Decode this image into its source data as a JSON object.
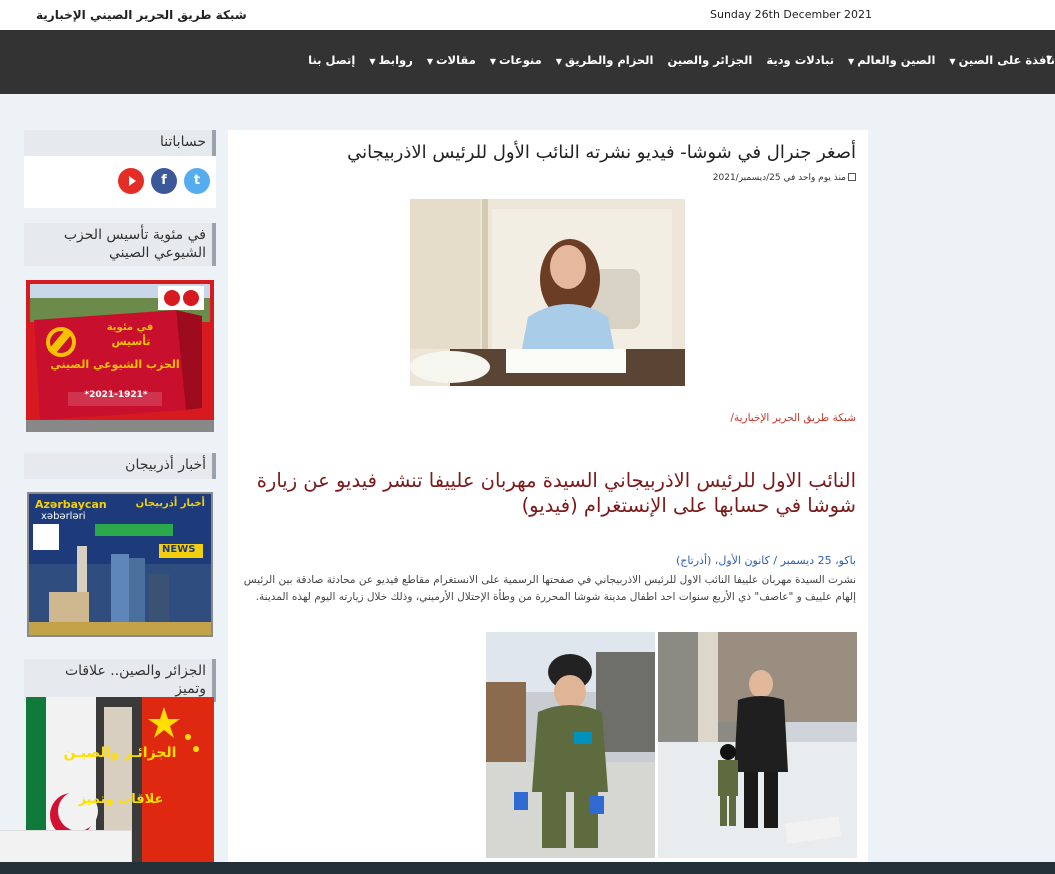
{
  "topbar": {
    "site_name": "شبكة طريق الحرير الصيني الإخبارية",
    "date": "Sunday 26th December 2021"
  },
  "nav": {
    "items": [
      {
        "label": "نافذة على الصين",
        "dropdown": true
      },
      {
        "label": "الصين والعالم",
        "dropdown": true
      },
      {
        "label": "تبادلات ودية",
        "dropdown": false
      },
      {
        "label": "الجزائر والصين",
        "dropdown": false
      },
      {
        "label": "الحزام والطريق",
        "dropdown": true
      },
      {
        "label": "منوعات",
        "dropdown": true
      },
      {
        "label": "مقالات",
        "dropdown": true
      },
      {
        "label": "روابط",
        "dropdown": true
      },
      {
        "label": "إتصل بنا",
        "dropdown": false
      }
    ]
  },
  "sidebar": {
    "accounts_title": "حساباتنا",
    "social": [
      "twitter-icon",
      "facebook-icon",
      "youtube-icon"
    ],
    "cpc_title": "في مئوية تأسيس الحزب الشيوعي الصيني",
    "cpc_banner": {
      "line1": "في مئوية",
      "line2": "تأسيس",
      "line3": "الحزب الشيوعي الصيني",
      "years": "*2021-1921*"
    },
    "azer_title": "أخبار أذربيجان",
    "azer_banner": {
      "ar": "أخبار أذربيجان",
      "az1": "Azərbaycan",
      "az2": "xəbərləri",
      "news": "NEWS"
    },
    "algeria_title": "الجزائر والصين.. علاقات وتميز",
    "algeria_banner": {
      "line1": "الجزائـر والصيـن",
      "line2": "علاقات وتميز"
    }
  },
  "article": {
    "title": "أصغر جنرال في شوشا- فيديو نشرته النائب الأول للرئيس الاذربيجاني",
    "meta": "منذ يوم واحد في 25/ديسمبر/2021",
    "source": "شبكة طريق الحرير الإخبارية/",
    "headline": "النائب الاول للرئيس الاذربيجاني السيدة مهربان علييفا تنشر فيديو عن زيارة شوشا في حسابها على الإنستغرام (فيديو)",
    "dateline": "باكو، 25 ديسمبر / كانون الأول، (أذرتاج)",
    "body": "نشرت السيدة مهربان علييفا النائب الاول للرئيس الاذربيجاني في صفحتها الرسمية على الانستغرام مقاطع فيديو عن محادثة صادقة بين الرئيس إلهام علييف و \"عاصف\" ذي الأربع سنوات احد اطفال مدينة شوشا المحررة من وطأة الإحتلال الأرميني، وذلك خلال زيارته اليوم لهذه المدينة."
  },
  "colors": {
    "navbar": "#333333",
    "headline": "#7a1a1a",
    "source_link": "#c0392b",
    "dateline_link": "#2b5fb4",
    "twitter": "#55acee",
    "facebook": "#3b5998",
    "youtube": "#e52d27"
  }
}
